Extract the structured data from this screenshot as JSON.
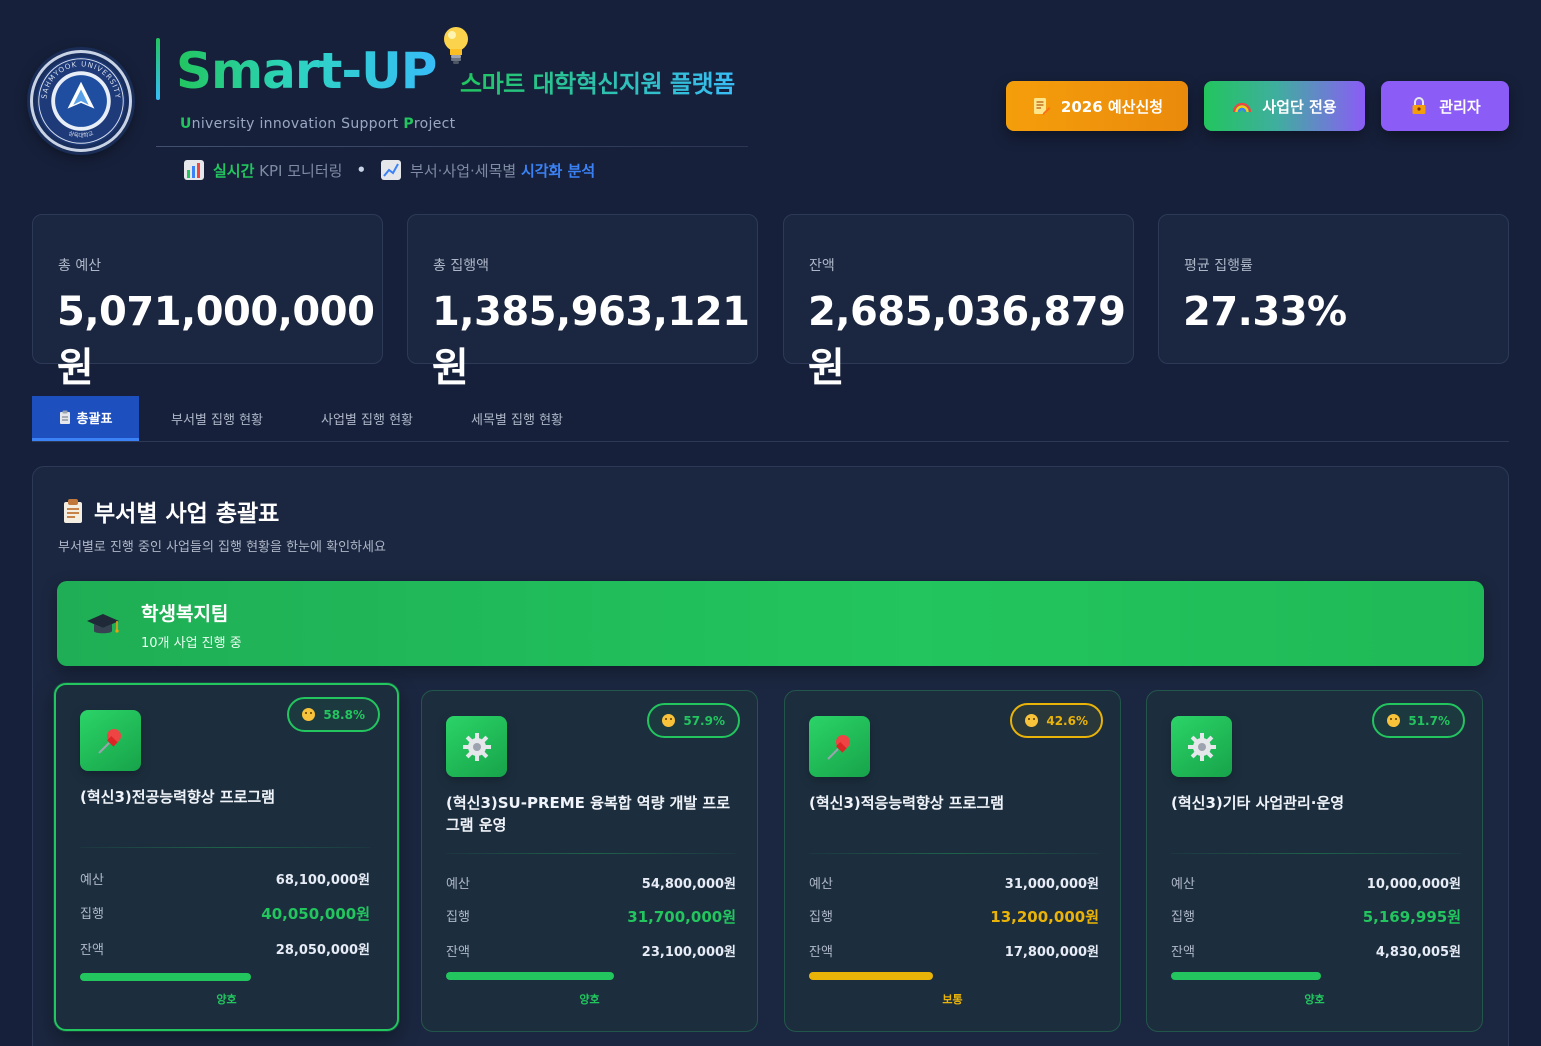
{
  "header": {
    "seal_text": "SAHMYOOK UNIVERSITY",
    "seal_year": "1906",
    "seal_korean": "삼육대학교",
    "title": "Smart-UP",
    "subtitle": "스마트 대학혁신지원 플랫폼",
    "tagline_u": "U",
    "tagline_1": "niversity innovation Support ",
    "tagline_p": "P",
    "tagline_2": "roject",
    "features": {
      "f1_hi": "실시간",
      "f1_rest": " KPI 모니터링",
      "separator": "•",
      "f2_rest": "부서·사업·세목별 ",
      "f2_hi": "시각화 분석"
    },
    "buttons": {
      "budget": "2026 예산신청",
      "team": "사업단 전용",
      "admin": "관리자"
    }
  },
  "stats": [
    {
      "label": "총 예산",
      "value": "5,071,000,000원"
    },
    {
      "label": "총 집행액",
      "value": "1,385,963,121원"
    },
    {
      "label": "잔액",
      "value": "2,685,036,879원"
    },
    {
      "label": "평균 집행률",
      "value": "27.33%"
    }
  ],
  "tabs": [
    {
      "label": "총괄표",
      "active": true
    },
    {
      "label": "부서별 집행 현황",
      "active": false
    },
    {
      "label": "사업별 집행 현황",
      "active": false
    },
    {
      "label": "세목별 집행 현황",
      "active": false
    }
  ],
  "panel": {
    "title": "부서별 사업 총괄표",
    "description": "부서별로 진행 중인 사업들의 집행 현황을 한눈에 확인하세요"
  },
  "department": {
    "name": "학생복지팀",
    "count_text": "10개 사업 진행 중"
  },
  "projects": [
    {
      "icon": "pushpin-icon",
      "rate": "58.8%",
      "rate_value": 0.588,
      "title": "(혁신3)전공능력향상 프로그램",
      "budget_label": "예산",
      "budget": "68,100,000원",
      "exec_label": "집행",
      "exec": "40,050,000원",
      "remain_label": "잔액",
      "remain": "28,050,000원",
      "status": "양호",
      "color": "#22c55e"
    },
    {
      "icon": "gear-icon",
      "rate": "57.9%",
      "rate_value": 0.579,
      "title": "(혁신3)SU-PREME 융복합 역량 개발 프로그램 운영",
      "budget_label": "예산",
      "budget": "54,800,000원",
      "exec_label": "집행",
      "exec": "31,700,000원",
      "remain_label": "잔액",
      "remain": "23,100,000원",
      "status": "양호",
      "color": "#22c55e"
    },
    {
      "icon": "pushpin-icon",
      "rate": "42.6%",
      "rate_value": 0.426,
      "title": "(혁신3)적응능력향상 프로그램",
      "budget_label": "예산",
      "budget": "31,000,000원",
      "exec_label": "집행",
      "exec": "13,200,000원",
      "remain_label": "잔액",
      "remain": "17,800,000원",
      "status": "보통",
      "color": "#eab308"
    },
    {
      "icon": "gear-icon",
      "rate": "51.7%",
      "rate_value": 0.517,
      "title": "(혁신3)기타 사업관리·운영",
      "budget_label": "예산",
      "budget": "10,000,000원",
      "exec_label": "집행",
      "exec": "5,169,995원",
      "remain_label": "잔액",
      "remain": "4,830,005원",
      "status": "양호",
      "color": "#22c55e"
    }
  ]
}
